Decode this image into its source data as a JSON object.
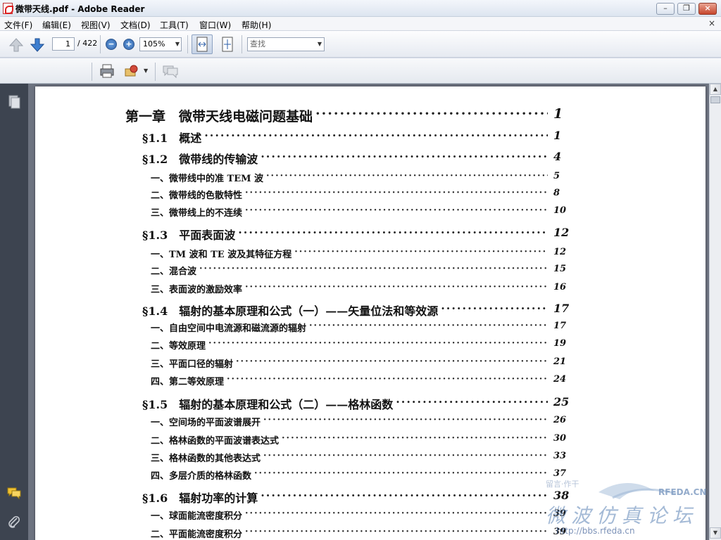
{
  "window": {
    "title": "微带天线.pdf - Adobe Reader"
  },
  "menu": [
    "文件(F)",
    "编辑(E)",
    "视图(V)",
    "文档(D)",
    "工具(T)",
    "窗口(W)",
    "帮助(H)"
  ],
  "menu_close": "×",
  "toolbar": {
    "page_current": "1",
    "page_total": "/ 422",
    "zoom": "105%",
    "find_placeholder": "查找"
  },
  "toc": [
    {
      "level": 0,
      "title": "第一章　微带天线电磁问题基础",
      "page": "1"
    },
    {
      "level": 1,
      "title": "§1.1　概述",
      "page": "1"
    },
    {
      "level": 1,
      "title": "§1.2　微带线的传输波",
      "page": "4"
    },
    {
      "level": 2,
      "title": "一、微带线中的准 TEM 波",
      "page": "5"
    },
    {
      "level": 2,
      "title": "二、微带线的色散特性",
      "page": "8"
    },
    {
      "level": 2,
      "title": "三、微带线上的不连续",
      "page": "10"
    },
    {
      "level": 1,
      "title": "§1.3　平面表面波",
      "page": "12"
    },
    {
      "level": 2,
      "title": "一、TM 波和 TE 波及其特征方程",
      "page": "12"
    },
    {
      "level": 2,
      "title": "二、混合波",
      "page": "15"
    },
    {
      "level": 2,
      "title": "三、表面波的激励效率",
      "page": "16"
    },
    {
      "level": 1,
      "title": "§1.4　辐射的基本原理和公式（一）——矢量位法和等效源",
      "page": "17"
    },
    {
      "level": 2,
      "title": "一、自由空间中电流源和磁流源的辐射",
      "page": "17"
    },
    {
      "level": 2,
      "title": "二、等效原理",
      "page": "19"
    },
    {
      "level": 2,
      "title": "三、平面口径的辐射",
      "page": "21"
    },
    {
      "level": 2,
      "title": "四、第二等效原理",
      "page": "24"
    },
    {
      "level": 1,
      "title": "§1.5　辐射的基本原理和公式（二）——格林函数",
      "page": "25"
    },
    {
      "level": 2,
      "title": "一、空间场的平面波谱展开",
      "page": "26"
    },
    {
      "level": 2,
      "title": "二、格林函数的平面波谱表达式",
      "page": "30"
    },
    {
      "level": 2,
      "title": "三、格林函数的其他表达式",
      "page": "33"
    },
    {
      "level": 2,
      "title": "四、多层介质的格林函数",
      "page": "37"
    },
    {
      "level": 1,
      "title": "§1.6　辐射功率的计算",
      "page": "38"
    },
    {
      "level": 2,
      "title": "一、球面能流密度积分",
      "page": "39"
    },
    {
      "level": 2,
      "title": "二、平面能流密度积分",
      "page": "39"
    }
  ],
  "watermark": {
    "small": "留言·作干",
    "brand": "RFEDA.CN",
    "big": "微波仿真论坛",
    "url": "http://bbs.rfeda.cn"
  },
  "colors": {
    "rail": "#3d4450",
    "docbg": "#6d7380",
    "accent": "#2b5ea8"
  }
}
